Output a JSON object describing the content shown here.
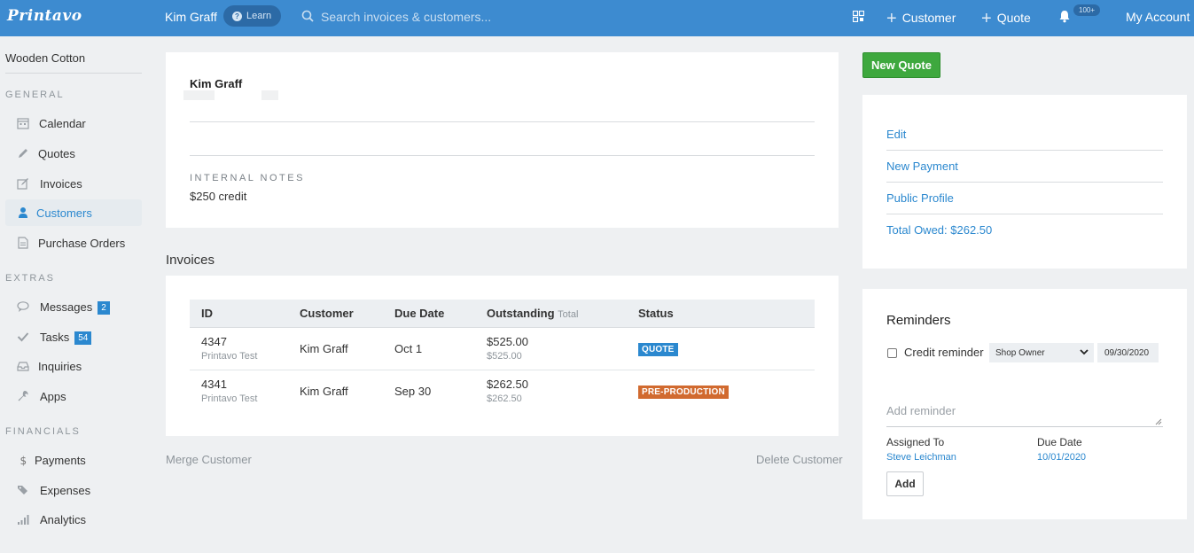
{
  "topbar": {
    "logo": "Printavo",
    "customer_name": "Kim Graff",
    "learn_label": "Learn",
    "search_placeholder": "Search invoices & customers...",
    "new_customer_label": "Customer",
    "new_quote_label": "Quote",
    "notification_count": "100+",
    "account_label": "My Account"
  },
  "sidebar": {
    "company": "Wooden Cotton",
    "general_label": "GENERAL",
    "extras_label": "EXTRAS",
    "financials_label": "FINANCIALS",
    "general_items": [
      {
        "label": "Calendar",
        "icon": "calendar-icon"
      },
      {
        "label": "Quotes",
        "icon": "pencil-icon"
      },
      {
        "label": "Invoices",
        "icon": "edit-icon"
      },
      {
        "label": "Customers",
        "icon": "user-icon",
        "active": true
      },
      {
        "label": "Purchase Orders",
        "icon": "document-icon"
      }
    ],
    "extras_items": [
      {
        "label": "Messages",
        "icon": "chat-icon",
        "count": "2"
      },
      {
        "label": "Tasks",
        "icon": "check-icon",
        "count": "54"
      },
      {
        "label": "Inquiries",
        "icon": "inbox-icon"
      },
      {
        "label": "Apps",
        "icon": "wrench-icon"
      }
    ],
    "financials_items": [
      {
        "label": "Payments",
        "icon": "dollar-icon"
      },
      {
        "label": "Expenses",
        "icon": "tags-icon"
      },
      {
        "label": "Analytics",
        "icon": "bar-chart-icon"
      }
    ]
  },
  "profile": {
    "name": "Kim Graff",
    "internal_notes_label": "INTERNAL NOTES",
    "internal_notes": "$250 credit"
  },
  "invoices": {
    "heading": "Invoices",
    "columns": {
      "id": "ID",
      "customer": "Customer",
      "due_date": "Due Date",
      "outstanding": "Outstanding",
      "outstanding_sub": "Total",
      "status": "Status"
    },
    "rows": [
      {
        "id": "4347",
        "sub": "Printavo Test",
        "customer": "Kim Graff",
        "due": "Oct 1",
        "outstanding": "$525.00",
        "total": "$525.00",
        "status": "QUOTE"
      },
      {
        "id": "4341",
        "sub": "Printavo Test",
        "customer": "Kim Graff",
        "due": "Sep 30",
        "outstanding": "$262.50",
        "total": "$262.50",
        "status": "PRE-PRODUCTION"
      }
    ]
  },
  "footer_links": {
    "merge": "Merge Customer",
    "delete": "Delete Customer"
  },
  "right": {
    "new_quote": "New Quote",
    "actions": [
      "Edit",
      "New Payment",
      "Public Profile",
      "Total Owed: $262.50"
    ]
  },
  "reminders": {
    "title": "Reminders",
    "checkbox_label": "Credit reminder",
    "select_value": "Shop Owner",
    "date_value": "09/30/2020",
    "add_placeholder": "Add reminder",
    "assigned_label": "Assigned To",
    "assigned_value": "Steve Leichman",
    "due_label": "Due Date",
    "due_value": "10/01/2020",
    "add_button": "Add"
  },
  "colors": {
    "topbar": "#3d8bd0",
    "accent": "#2b88cf",
    "quote_status": "#2b88cf",
    "pre_production_status": "#d16a2f",
    "new_quote_button": "#3ea83e"
  }
}
